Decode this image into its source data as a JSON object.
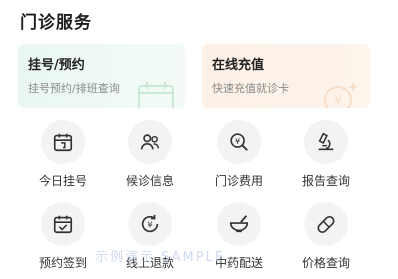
{
  "section": {
    "title": "门诊服务"
  },
  "cards": [
    {
      "title": "挂号/预约",
      "subtitle": "挂号预约/排班查询",
      "icon": "calendar-icon"
    },
    {
      "title": "在线充值",
      "subtitle": "快速充值就诊卡",
      "icon": "yuen-plus-icon"
    }
  ],
  "services": [
    {
      "label": "今日挂号",
      "icon": "calendar-plus-icon"
    },
    {
      "label": "候诊信息",
      "icon": "patients-icon"
    },
    {
      "label": "门诊费用",
      "icon": "yen-search-icon"
    },
    {
      "label": "报告查询",
      "icon": "microscope-icon"
    },
    {
      "label": "预约签到",
      "icon": "calendar-check-icon"
    },
    {
      "label": "线上退款",
      "icon": "yen-return-icon"
    },
    {
      "label": "中药配送",
      "icon": "mortar-icon"
    },
    {
      "label": "价格查询",
      "icon": "pill-icon"
    }
  ],
  "watermark": "示例演示 SAMPLE"
}
